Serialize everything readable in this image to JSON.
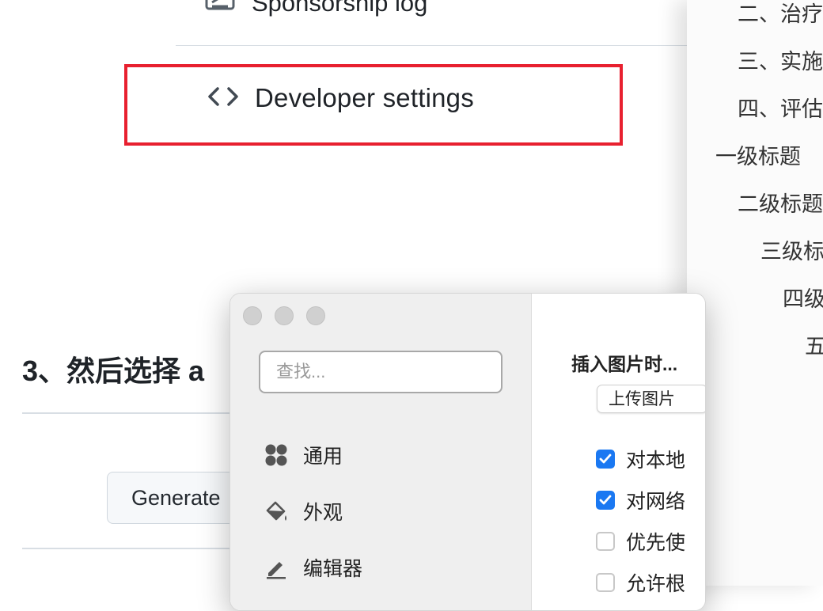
{
  "github": {
    "sponsorship_log": "Sponsorship log",
    "developer_settings": "Developer settings",
    "step_heading": "3、然后选择 a",
    "generate_button": "Generate"
  },
  "outline": {
    "items": [
      "二、治疗",
      "三、实施",
      "四、评估",
      "一级标题",
      "二级标题",
      "三级标",
      "四级",
      "五"
    ]
  },
  "settings": {
    "search_placeholder": "查找...",
    "nav": [
      {
        "label": "通用",
        "icon": "grid-icon"
      },
      {
        "label": "外观",
        "icon": "paint-bucket-icon"
      },
      {
        "label": "编辑器",
        "icon": "pencil-icon"
      }
    ],
    "insert_image_title": "插入图片时...",
    "upload_button": "上传图片",
    "options": [
      {
        "label": "对本地",
        "checked": true
      },
      {
        "label": "对网络",
        "checked": true
      },
      {
        "label": "优先使",
        "checked": false
      },
      {
        "label": "允许根",
        "checked": false
      }
    ]
  },
  "colors": {
    "highlight": "#e8202f",
    "checkbox_on": "#1a78f2"
  }
}
